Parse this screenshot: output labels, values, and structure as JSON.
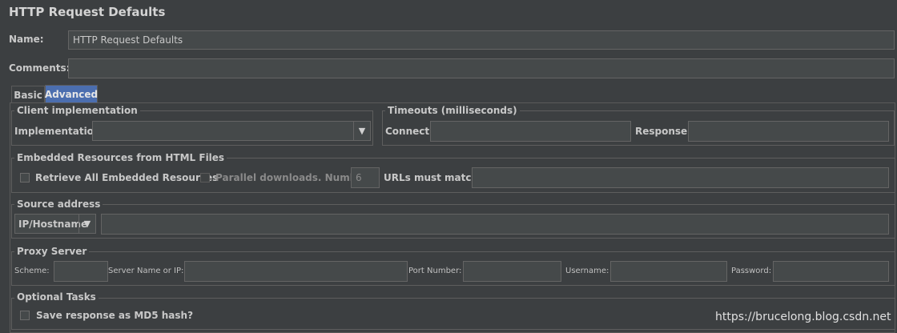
{
  "page": {
    "title": "HTTP Request Defaults"
  },
  "form": {
    "name_label": "Name:",
    "name_value": "HTTP Request Defaults",
    "comments_label": "Comments:",
    "comments_value": ""
  },
  "tabs": [
    {
      "label": "Basic",
      "active": false
    },
    {
      "label": "Advanced",
      "active": true
    }
  ],
  "client_impl": {
    "title": "Client implementation",
    "impl_label": "Implementation:",
    "impl_value": ""
  },
  "timeouts": {
    "title": "Timeouts (milliseconds)",
    "connect_label": "Connect:",
    "connect_value": "",
    "response_label": "Response:",
    "response_value": ""
  },
  "embedded": {
    "title": "Embedded Resources from HTML Files",
    "retrieve_label": "Retrieve All Embedded Resources",
    "parallel_label": "Parallel downloads. Number:",
    "parallel_value": "6",
    "urls_label": "URLs must match:",
    "urls_value": ""
  },
  "source": {
    "title": "Source address",
    "type_value": "IP/Hostname",
    "address_value": ""
  },
  "proxy": {
    "title": "Proxy Server",
    "scheme_label": "Scheme:",
    "server_label": "Server Name or IP:",
    "port_label": "Port Number:",
    "username_label": "Username:",
    "password_label": "Password:"
  },
  "optional": {
    "title": "Optional Tasks",
    "md5_label": "Save response as MD5 hash?"
  },
  "watermark": "https://brucelong.blog.csdn.net",
  "colors": {
    "background": "#3c3f41",
    "field": "#45494a",
    "active_tab": "#4b6eaf"
  }
}
